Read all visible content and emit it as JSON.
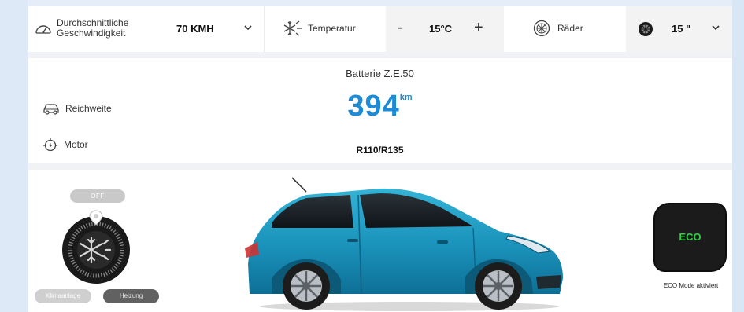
{
  "controls": {
    "speed": {
      "label_line1": "Durchschnittliche",
      "label_line2": "Geschwindigkeit",
      "value": "70 KMH"
    },
    "temperature": {
      "label": "Temperatur",
      "minus": "-",
      "value": "15°C",
      "plus": "+"
    },
    "wheels": {
      "label": "Räder",
      "value": "15 \""
    }
  },
  "info": {
    "battery_title": "Batterie Z.E.50",
    "range_label": "Reichweite",
    "range_value": "394",
    "range_unit": "km",
    "motor_label": "Motor",
    "motor_value": "R110/R135"
  },
  "climate": {
    "off_label": "OFF",
    "mode_ac": "Klimaanlage",
    "mode_heat": "Heizung"
  },
  "eco": {
    "button_label": "ECO",
    "caption": "ECO Mode aktiviert",
    "color": "#2fcf3e"
  },
  "colors": {
    "accent": "#1d8bd6",
    "car_body": "#1c93b9"
  },
  "icons": {
    "speed": "speedometer-icon",
    "temperature": "snowflake-sun-icon",
    "wheels": "wheel-icon",
    "range": "car-range-icon",
    "motor": "motor-icon",
    "climate": "snowflake-dial-icon"
  }
}
